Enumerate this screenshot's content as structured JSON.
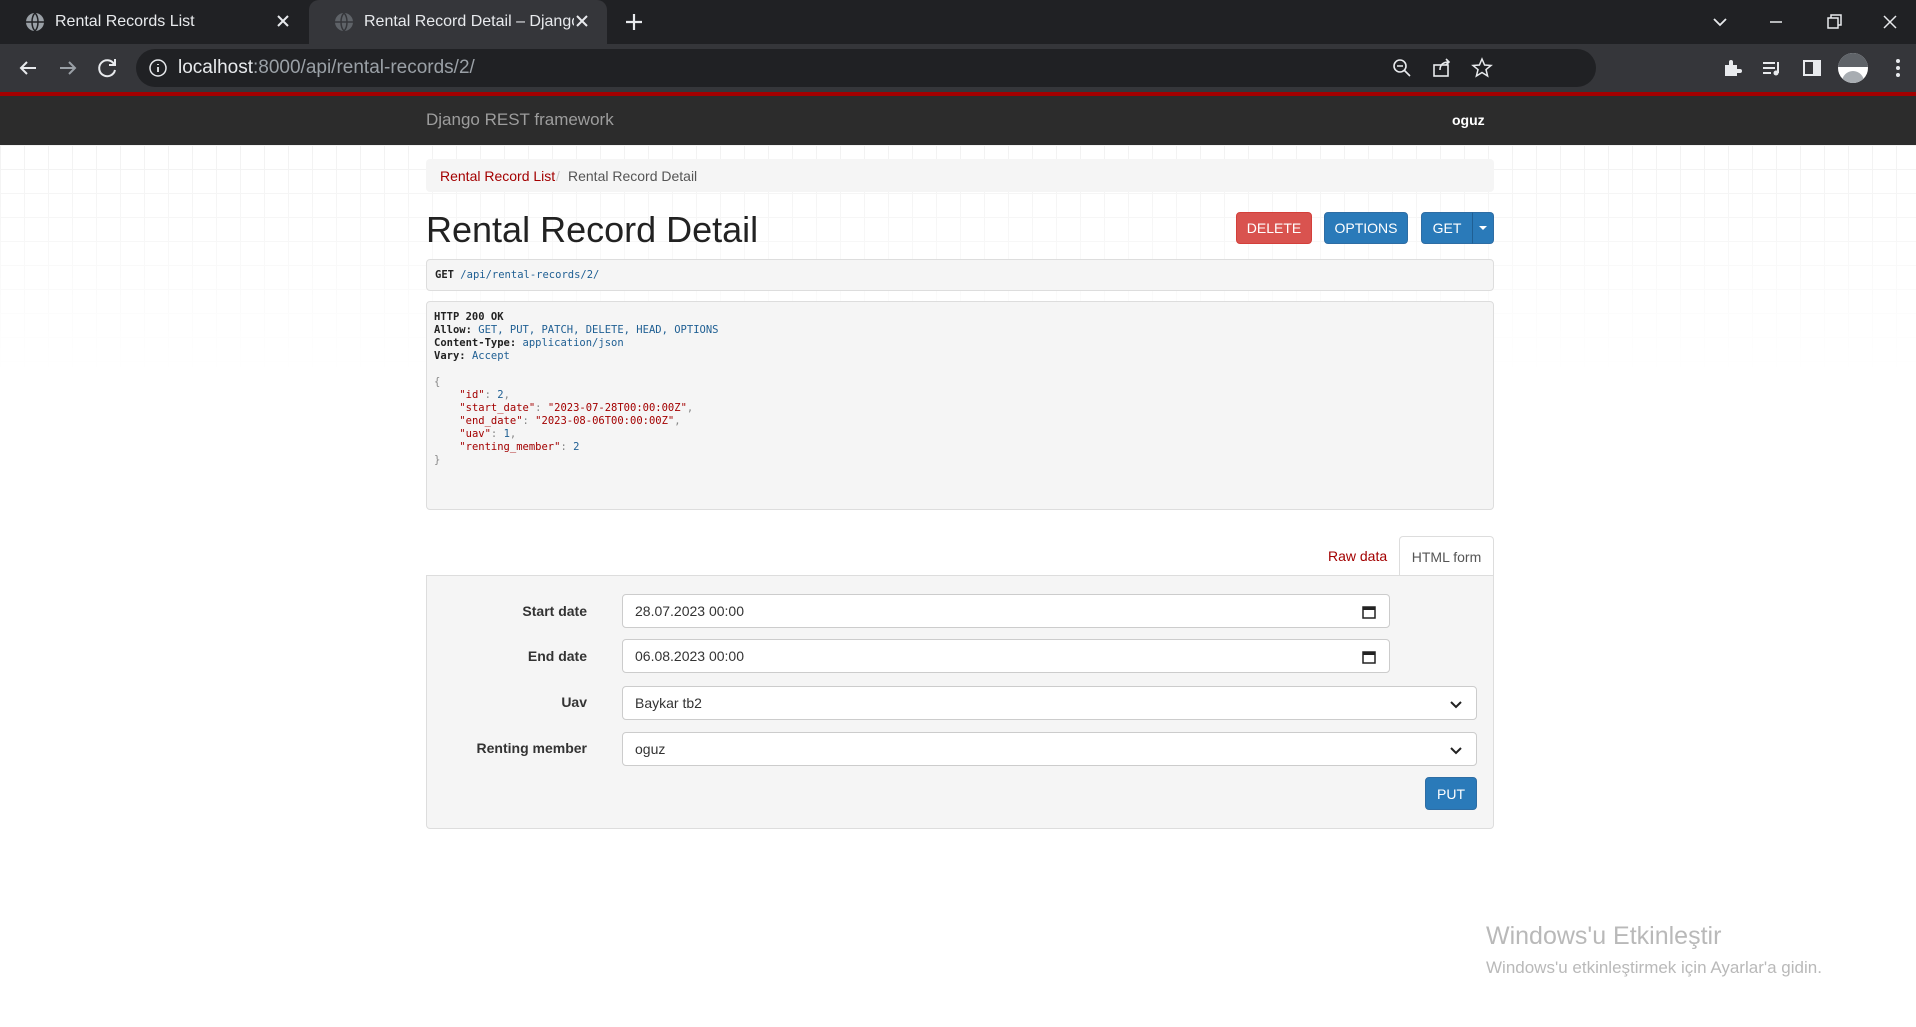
{
  "browser": {
    "tabs": [
      {
        "title": "Rental Records List"
      },
      {
        "title": "Rental Record Detail – Django REST framework"
      }
    ],
    "url": {
      "host": "localhost",
      "path": ":8000/api/rental-records/2/"
    }
  },
  "drf": {
    "brand": "Django REST framework",
    "user": "oguz",
    "breadcrumb": {
      "list_link": "Rental Record List",
      "separator": "/",
      "active": "Rental Record Detail"
    },
    "title": "Rental Record Detail",
    "buttons": {
      "delete": "DELETE",
      "options": "OPTIONS",
      "get": "GET",
      "put": "PUT"
    },
    "request": {
      "method": "GET",
      "path": "/api/rental-records/2/"
    },
    "response": {
      "status": "HTTP 200 OK",
      "headers": [
        {
          "name": "Allow:",
          "value": "GET, PUT, PATCH, DELETE, HEAD, OPTIONS"
        },
        {
          "name": "Content-Type:",
          "value": "application/json"
        },
        {
          "name": "Vary:",
          "value": "Accept"
        }
      ],
      "body": {
        "open": "{",
        "fields": [
          {
            "key": "\"id\"",
            "value": "2",
            "comma": ","
          },
          {
            "key": "\"start_date\"",
            "value": "\"2023-07-28T00:00:00Z\"",
            "comma": ","
          },
          {
            "key": "\"end_date\"",
            "value": "\"2023-08-06T00:00:00Z\"",
            "comma": ","
          },
          {
            "key": "\"uav\"",
            "value": "1",
            "comma": ","
          },
          {
            "key": "\"renting_member\"",
            "value": "2",
            "comma": ""
          }
        ],
        "close": "}"
      }
    },
    "form_tabs": {
      "raw": "Raw data",
      "html": "HTML form"
    },
    "form": {
      "start_date_label": "Start date",
      "start_date_value": "28.07.2023 00:00",
      "end_date_label": "End date",
      "end_date_value": "06.08.2023 00:00",
      "uav_label": "Uav",
      "uav_value": "Baykar tb2",
      "renting_member_label": "Renting member",
      "renting_member_value": "oguz"
    }
  },
  "windows_watermark": {
    "line1": "Windows'u Etkinleştir",
    "line2": "Windows'u etkinleştirmek için Ayarlar'a gidin."
  },
  "colors": {
    "accent_red": "#a30000",
    "delete_red": "#d9534f",
    "primary_blue": "#2a7ab9",
    "navbar_dark": "#2c2c2c"
  }
}
